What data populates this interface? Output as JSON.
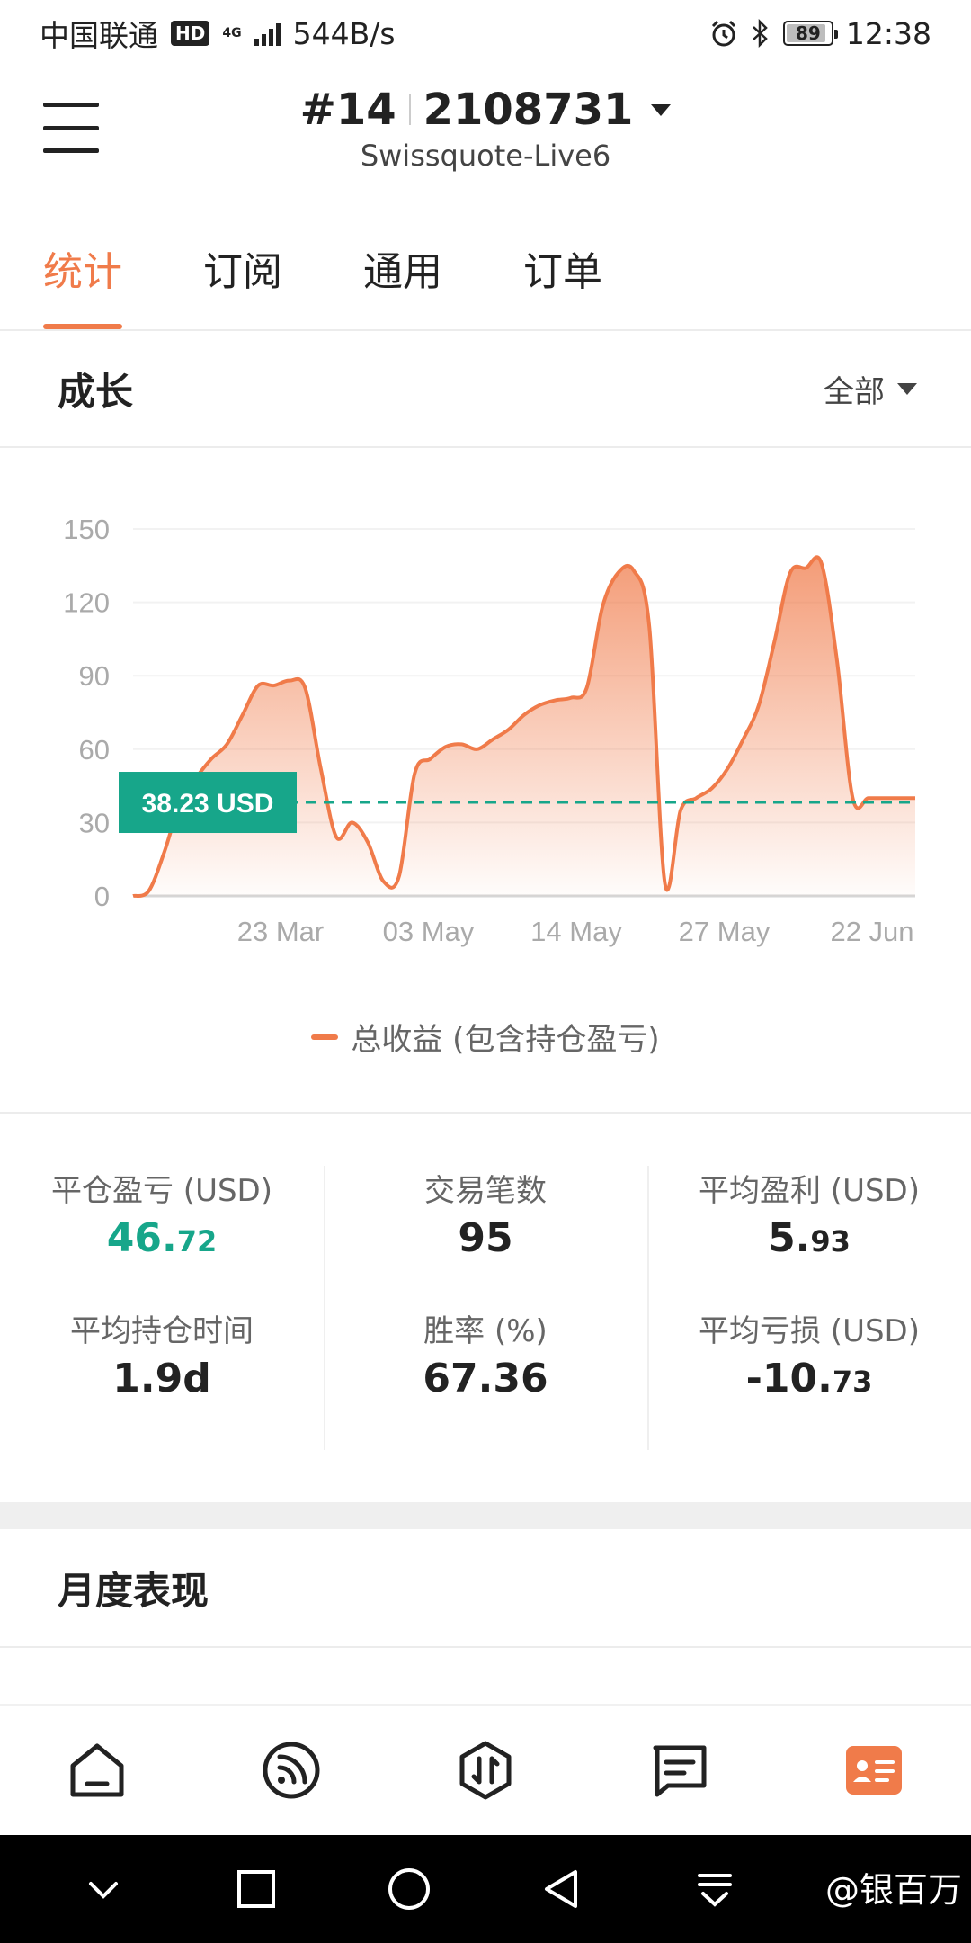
{
  "status_bar": {
    "carrier": "中国联通",
    "hd": "HD",
    "network": "4G",
    "speed": "544B/s",
    "battery": "89",
    "battery_level": 0.89,
    "time": "12:38"
  },
  "header": {
    "account_prefix": "#14",
    "account_number": "2108731",
    "server": "Swissquote-Live6"
  },
  "tabs": [
    {
      "label": "统计",
      "active": true
    },
    {
      "label": "订阅",
      "active": false
    },
    {
      "label": "通用",
      "active": false
    },
    {
      "label": "订单",
      "active": false
    }
  ],
  "growth": {
    "title": "成长",
    "range": "全部"
  },
  "chart_data": {
    "type": "area",
    "series": [
      {
        "name": "总收益 (包含持仓盈亏)",
        "color": "#f07b4a",
        "x": [
          0,
          1,
          2,
          3,
          4,
          5,
          6,
          7,
          8,
          9,
          10,
          11,
          12,
          13,
          14,
          15,
          16,
          17,
          18,
          19,
          20,
          21,
          22,
          23,
          24,
          25,
          26,
          27,
          28,
          29,
          30,
          31,
          32,
          33,
          34,
          35,
          36,
          37,
          38,
          39,
          40,
          41,
          42,
          43,
          44,
          45,
          46,
          47,
          48,
          49,
          50
        ],
        "values": [
          0,
          2,
          18,
          38,
          48,
          56,
          62,
          74,
          86,
          86,
          88,
          85,
          52,
          24,
          30,
          22,
          6,
          8,
          50,
          56,
          61,
          62,
          60,
          64,
          68,
          74,
          78,
          80,
          81,
          85,
          118,
          132,
          133,
          110,
          5,
          35,
          40,
          44,
          52,
          64,
          78,
          104,
          132,
          134,
          136,
          96,
          40,
          40,
          40,
          40,
          40
        ]
      }
    ],
    "x_tick_labels": [
      "23 Mar",
      "03 May",
      "14 May",
      "27 May",
      "22 Jun"
    ],
    "y_ticks": [
      0,
      30,
      60,
      90,
      120,
      150
    ],
    "ylim": [
      0,
      150
    ],
    "current_value": 38.23,
    "current_label": "38.23 USD",
    "reference_color": "#17a68a",
    "grid": true,
    "legend_position": "bottom-center"
  },
  "stats": [
    [
      {
        "label": "平仓盈亏 (USD)",
        "int": "46.",
        "dec": "72",
        "positive": true
      },
      {
        "label": "平均持仓时间",
        "int": "1.9d",
        "dec": "",
        "positive": false
      }
    ],
    [
      {
        "label": "交易笔数",
        "int": "95",
        "dec": "",
        "positive": false
      },
      {
        "label": "胜率 (%)",
        "int": "67.36",
        "dec": "",
        "positive": false
      }
    ],
    [
      {
        "label": "平均盈利 (USD)",
        "int": "5.",
        "dec": "93",
        "positive": false
      },
      {
        "label": "平均亏损 (USD)",
        "int": "-10.",
        "dec": "73",
        "positive": false
      }
    ]
  ],
  "monthly": {
    "title": "月度表现"
  },
  "bottom_nav": [
    {
      "icon": "home-icon",
      "active": false
    },
    {
      "icon": "signal-feed-icon",
      "active": false
    },
    {
      "icon": "trade-icon",
      "active": false
    },
    {
      "icon": "message-icon",
      "active": false
    },
    {
      "icon": "profile-card-icon",
      "active": true
    }
  ],
  "watermark": "@银百万",
  "colors": {
    "accent": "#f07b4a",
    "positive": "#17a68a",
    "text": "#222222",
    "muted": "#666666"
  }
}
